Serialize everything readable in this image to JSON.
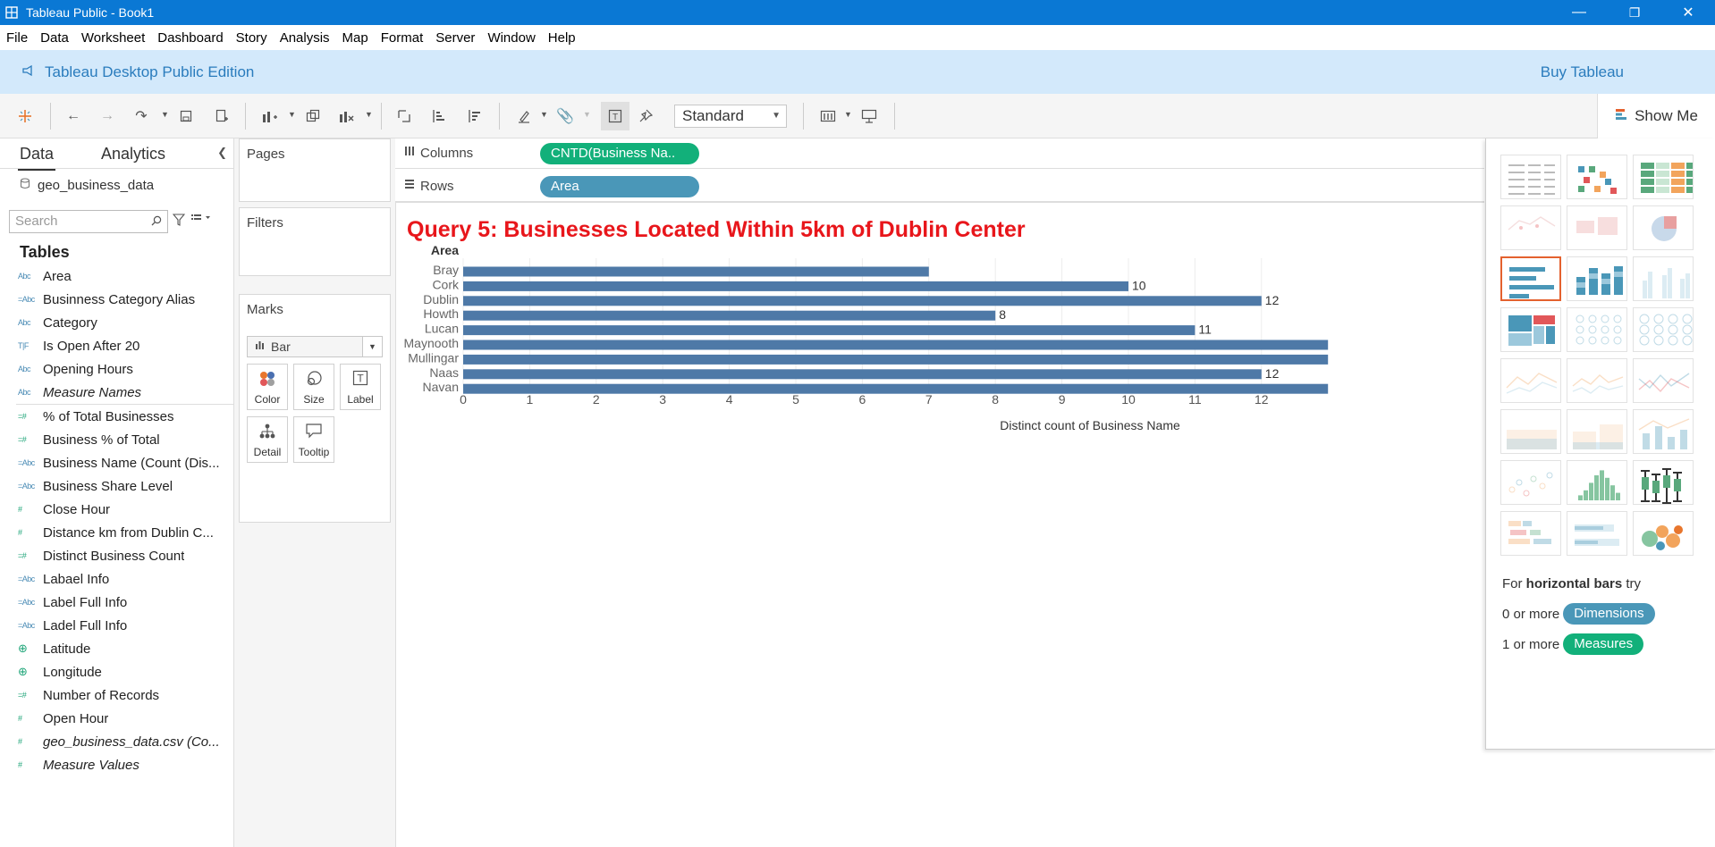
{
  "window": {
    "title": "Tableau Public - Book1",
    "controls": {
      "minimize": "—",
      "restore": "❐",
      "close": "✕"
    }
  },
  "menu": [
    "File",
    "Data",
    "Worksheet",
    "Dashboard",
    "Story",
    "Analysis",
    "Map",
    "Format",
    "Server",
    "Window",
    "Help"
  ],
  "banner": {
    "edition": "Tableau Desktop Public Edition",
    "buy": "Buy Tableau"
  },
  "toolbar": {
    "fit": "Standard",
    "show_me": "Show Me"
  },
  "data_pane": {
    "tabs": [
      "Data",
      "Analytics"
    ],
    "datasource": "geo_business_data",
    "search_placeholder": "Search",
    "tables_heading": "Tables",
    "dimensions": [
      {
        "type": "Abc",
        "name": "Area",
        "italic": false
      },
      {
        "type": "=Abc",
        "name": "Businness Category Alias",
        "italic": false
      },
      {
        "type": "Abc",
        "name": "Category",
        "italic": false
      },
      {
        "type": "T|F",
        "name": "Is Open After 20",
        "italic": false
      },
      {
        "type": "Abc",
        "name": "Opening Hours",
        "italic": false
      },
      {
        "type": "Abc",
        "name": "Measure Names",
        "italic": true
      }
    ],
    "measures": [
      {
        "type": "=#",
        "name": "% of Total Businesses",
        "italic": false
      },
      {
        "type": "=#",
        "name": "Business % of Total",
        "italic": false
      },
      {
        "type": "=Abc",
        "name": "Business Name (Count (Dis...",
        "italic": false
      },
      {
        "type": "=Abc",
        "name": "Business Share Level",
        "italic": false
      },
      {
        "type": "#",
        "name": "Close Hour",
        "italic": false
      },
      {
        "type": "#",
        "name": "Distance km from Dublin C...",
        "italic": false
      },
      {
        "type": "=#",
        "name": "Distinct Business Count",
        "italic": false
      },
      {
        "type": "=Abc",
        "name": "Labael Info",
        "italic": false
      },
      {
        "type": "=Abc",
        "name": "Label Full Info",
        "italic": false
      },
      {
        "type": "=Abc",
        "name": "Ladel Full Info",
        "italic": false
      },
      {
        "type": "geo",
        "name": "Latitude",
        "italic": false
      },
      {
        "type": "geo",
        "name": "Longitude",
        "italic": false
      },
      {
        "type": "=#",
        "name": "Number of Records",
        "italic": false
      },
      {
        "type": "#",
        "name": "Open Hour",
        "italic": false
      },
      {
        "type": "#",
        "name": "geo_business_data.csv (Co...",
        "italic": true
      },
      {
        "type": "#",
        "name": "Measure Values",
        "italic": true
      }
    ]
  },
  "cards": {
    "pages": "Pages",
    "filters": "Filters",
    "marks": "Marks",
    "mark_type": "Bar",
    "mark_buttons": [
      "Color",
      "Size",
      "Label",
      "Detail",
      "Tooltip"
    ]
  },
  "shelves": {
    "columns_label": "Columns",
    "columns_pill": "CNTD(Business Na..",
    "rows_label": "Rows",
    "rows_pill": "Area"
  },
  "worksheet": {
    "title": "Query 5: Businesses Located Within 5km of Dublin Center"
  },
  "chart_data": {
    "type": "bar",
    "orientation": "horizontal",
    "row_header": "Area",
    "categories": [
      "Bray",
      "Cork",
      "Dublin",
      "Howth",
      "Lucan",
      "Maynooth",
      "Mullingar",
      "Naas",
      "Navan"
    ],
    "values": [
      7,
      10,
      12,
      8,
      11,
      13,
      13,
      12,
      13
    ],
    "data_labels": [
      "",
      "10",
      "12",
      "8",
      "11",
      "",
      "",
      "12",
      ""
    ],
    "x_ticks": [
      0,
      1,
      2,
      3,
      4,
      5,
      6,
      7,
      8,
      9,
      10,
      11,
      12
    ],
    "xlabel": "Distinct count of Business Name",
    "xlim": [
      0,
      12.4
    ],
    "bar_color": "#4e79a7",
    "grid": true
  },
  "show_me": {
    "hint_prefix": "For ",
    "hint_bold": "horizontal bars",
    "hint_suffix": " try",
    "dim_prefix": "0 or more",
    "dim_pill": "Dimensions",
    "meas_prefix": "1 or more",
    "meas_pill": "Measures",
    "selected_index": 6
  },
  "colors": {
    "title_bar": "#0a78d4",
    "banner": "#d3e9fb",
    "dimension_pill": "#4a97b8",
    "measure_pill": "#12b07a",
    "sheet_title": "#e8161b",
    "selected_outline": "#e4612e"
  }
}
